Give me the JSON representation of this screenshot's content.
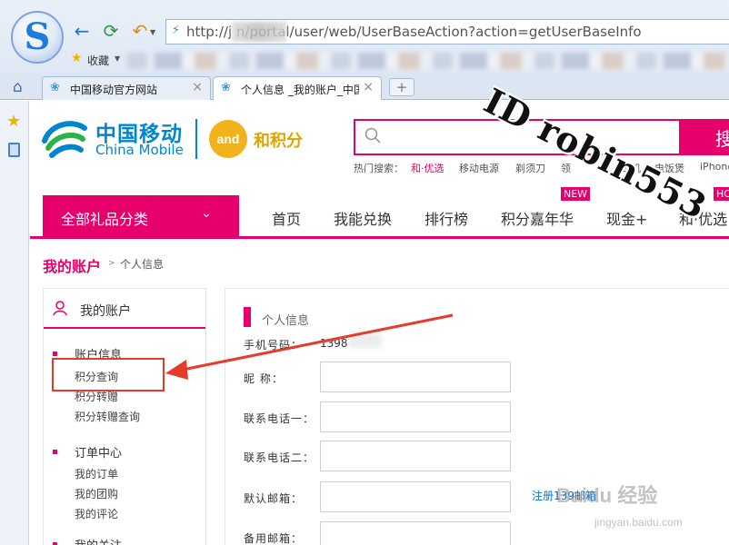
{
  "browser": {
    "address": "http://j          n/portal/user/web/UserBaseAction?action=getUserBaseInfo",
    "favorites_label": "收藏",
    "tabs": [
      {
        "label": "中国移动官方网站"
      },
      {
        "label": "个人信息 _我的账户_中国移动"
      }
    ],
    "new_tab_symbol": "+"
  },
  "header": {
    "brand_cn": "中国移动",
    "brand_en": "China Mobile",
    "hjf_badge": "and",
    "hjf_text": "和积分",
    "search_button_label": "搜",
    "hot_search_label": "热门搜索：",
    "hot_items": [
      "和·优选",
      "移动电源",
      "剃须刀",
      "领",
      "耳机",
      "电饭煲",
      "iPhone"
    ]
  },
  "nav": {
    "category_label": "全部礼品分类",
    "items": [
      "首页",
      "我能兑换",
      "排行榜",
      "积分嘉年华",
      "现金+",
      "和·优选"
    ],
    "badge_new": "NEW",
    "badge_hot": "HOT"
  },
  "breadcrumb": {
    "main": "我的账户",
    "separator": ">",
    "current": "个人信息"
  },
  "sidebar": {
    "title": "我的账户",
    "groups": [
      {
        "label": "账户信息",
        "links": [
          "积分查询",
          "积分转赠",
          "积分转赠查询"
        ]
      },
      {
        "label": "订单中心",
        "links": [
          "我的订单",
          "我的团购",
          "我的评论"
        ]
      },
      {
        "label": "我的关注",
        "links": []
      }
    ]
  },
  "profile": {
    "title": "个人信息",
    "phone_label": "手机号码：",
    "phone_value": "1398",
    "nickname_label": "昵    称：",
    "contact1_label": "联系电话一：",
    "contact2_label": "联系电话二：",
    "default_email_label": "默认邮箱：",
    "backup_email_label": "备用邮箱：",
    "register_link": "注册139邮箱"
  },
  "overlay": {
    "watermark": "ID robin553",
    "baidu_logo": "Baidu 经验",
    "baidu_url": "jingyan.baidu.com"
  },
  "colors": {
    "brand_magenta": "#e6006b",
    "china_mobile_blue": "#0085d0",
    "highlight_red": "#e63a2b",
    "link_blue": "#0a72c6"
  }
}
